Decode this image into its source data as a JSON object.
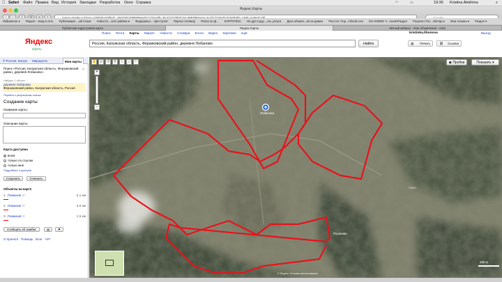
{
  "menubar": {
    "app": "Safari",
    "items": [
      "Файл",
      "Правка",
      "Вид",
      "История",
      "Закладки",
      "Разработка",
      "Окно",
      "Справка"
    ],
    "clock": "19:36",
    "user": "Kristina Alekhina"
  },
  "browser": {
    "window_title": "Яндекс.Карты",
    "url": "maps.yandex.ru/?um=YS0VNzg0jhmf...xN6ZaD2DPMWaH7CCOSA&ll=36.82727882C54.589396&spn=0.031774&Z0.0194938z=16&l=sat%2Cskl",
    "search_placeholder": "Google",
    "bookmarks": [
      "Избранное ▾",
      "Яндекс - вход в сеть",
      "Публикация ...ый отзыв",
      "Новости ...кого района ▾",
      "Федеральн... преступля",
      "Портал Антикор",
      "Поиск по ф...",
      "КАРТОТЕКА",
      "Не дуп в руд ...ать услуги",
      "Дата обновл...ая на домен",
      "Росстат. Пор...infoodi.com",
      "DS НОВОЕ Ч...mode/Раздел",
      "Росреест.Гос...vrkmap ▾",
      "Мои отзывы ▾",
      "Раздел ▾"
    ],
    "tabs": [
      "Публичная кадастровая карта",
      "Яндекс.Карты",
      "Личный кабинет - Мои объявления - Avito"
    ]
  },
  "header": {
    "logo": "Яндекс",
    "logo_sub": "карты",
    "services": [
      "Поиск",
      "Почта",
      "Карты",
      "Маркет",
      "Новости",
      "Словари",
      "Блоги",
      "Видео",
      "Картинки",
      "ещё"
    ],
    "current_service": "Карты",
    "user": "kristinka.lihonova",
    "exit": "Выход",
    "search_value": "Россия, Калужская область, Ферзиковский район, деревня Лобаново",
    "search_button": "Найти",
    "print": "Печать",
    "link": "Ссылка"
  },
  "sidebar": {
    "tabs": [
      "Россия, Калуж",
      "Маршруты",
      "Мои карты"
    ],
    "active_tab": "Мои карты",
    "search_result_title": "Поиск «Россия, Калужская область, Ферзиковский район, деревня Лобаново»",
    "found": "Найден 1 объект",
    "result_name": "деревня Лобаново",
    "result_address": "Ферзиковский район, Калужская область, Россия",
    "result_link": "Перейти к результатам поиска",
    "create_title": "Создание карты",
    "name_label": "Название карты:",
    "desc_label": "Описание карты:",
    "access_label": "Карта доступна",
    "access_options": [
      "всем",
      "только по ссылке",
      "только мне"
    ],
    "access_selected": "всем",
    "access_more": "Подробнее о доступе",
    "save": "Сохранить",
    "cancel": "Отменить",
    "objects_title": "Объекты на карте",
    "objects": [
      {
        "num": "1",
        "name": "Ломаная",
        "length": "2.1 км"
      },
      {
        "num": "2",
        "name": "Ломаная",
        "length": "3.0 км"
      },
      {
        "num": "3",
        "name": "Ломаная",
        "length": "1.5 км"
      }
    ],
    "report_error": "Сообщить об ошибке",
    "footer_links": [
      "О проекте",
      "Помощь",
      "Блог",
      "API"
    ]
  },
  "map": {
    "traffic_button": "Пробки",
    "show_button": "Показать ▾",
    "village_label": "Лобаново",
    "village2_label": "Русиново",
    "place_label": "Ушко",
    "scale": "200 м",
    "copyright": "© Яндекс. Условия использования",
    "outline_color": "#e8121c"
  }
}
